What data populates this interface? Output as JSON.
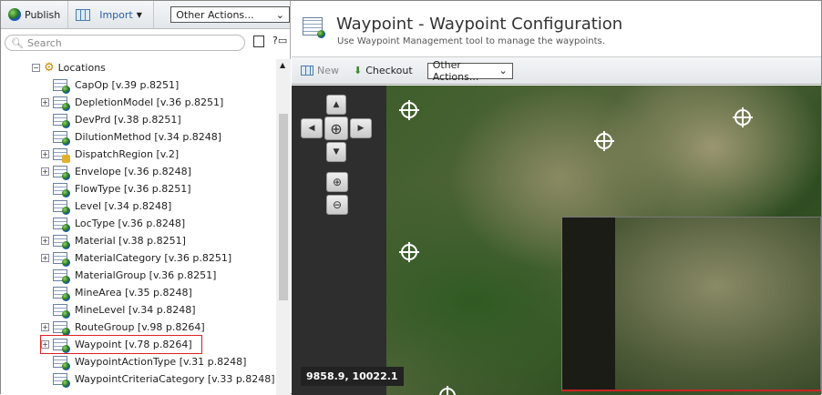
{
  "left_toolbar": {
    "publish": "Publish",
    "import": "Import",
    "other_actions": "Other Actions..."
  },
  "search": {
    "placeholder": "Search"
  },
  "tree": {
    "root": "Locations",
    "items": [
      {
        "label": "CapOp [v.39 p.8251]",
        "expandable": false
      },
      {
        "label": "DepletionModel [v.36 p.8251]",
        "expandable": true
      },
      {
        "label": "DevPrd [v.38 p.8251]",
        "expandable": false
      },
      {
        "label": "DilutionMethod [v.34 p.8248]",
        "expandable": false
      },
      {
        "label": "DispatchRegion [v.2]",
        "expandable": true,
        "locked": true
      },
      {
        "label": "Envelope [v.36 p.8248]",
        "expandable": true
      },
      {
        "label": "FlowType [v.36 p.8251]",
        "expandable": false
      },
      {
        "label": "Level [v.34 p.8248]",
        "expandable": false
      },
      {
        "label": "LocType [v.36 p.8248]",
        "expandable": false
      },
      {
        "label": "Material [v.38 p.8251]",
        "expandable": true
      },
      {
        "label": "MaterialCategory [v.36 p.8251]",
        "expandable": true
      },
      {
        "label": "MaterialGroup [v.36 p.8251]",
        "expandable": false
      },
      {
        "label": "MineArea [v.35 p.8248]",
        "expandable": false
      },
      {
        "label": "MineLevel [v.34 p.8248]",
        "expandable": false
      },
      {
        "label": "RouteGroup [v.98 p.8264]",
        "expandable": true
      },
      {
        "label": "Waypoint [v.78 p.8264]",
        "expandable": true,
        "selected": true
      },
      {
        "label": "WaypointActionType [v.31 p.8248]",
        "expandable": false
      },
      {
        "label": "WaypointCriteriaCategory [v.33 p.8248]",
        "expandable": false
      }
    ]
  },
  "header": {
    "title": "Waypoint - Waypoint Configuration",
    "subtitle": "Use Waypoint Management tool to manage the waypoints."
  },
  "toolbar": {
    "new": "New",
    "checkout": "Checkout",
    "other_actions": "Other Actions..."
  },
  "map": {
    "coordinates": "9858.9, 10022.1"
  }
}
